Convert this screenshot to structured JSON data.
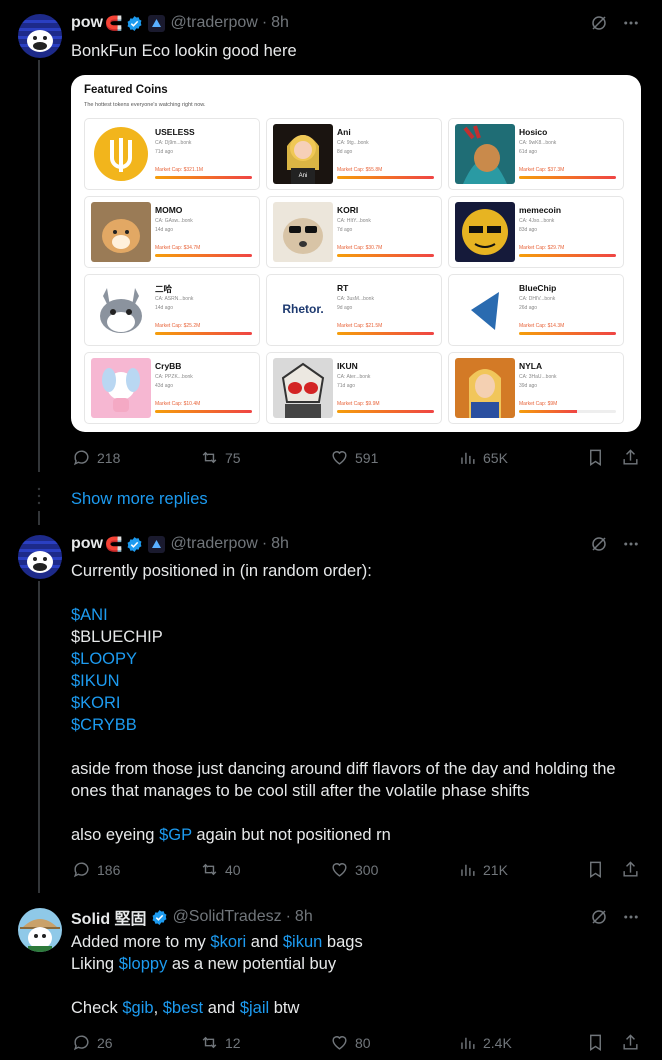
{
  "tweets": [
    {
      "name": "pow",
      "handle": "@traderpow",
      "sep": "·",
      "time": "8h",
      "text": "BonkFun Eco lookin good here",
      "actions": {
        "replies": "218",
        "reposts": "75",
        "likes": "591",
        "views": "65K"
      }
    },
    {
      "name": "pow",
      "handle": "@traderpow",
      "sep": "·",
      "time": "8h",
      "intro": "Currently positioned in (in random order):",
      "tickers": [
        "$ANI",
        "$BLUECHIP",
        "$LOOPY",
        "$IKUN",
        "$KORI",
        "$CRYBB"
      ],
      "para1_line1": "aside from those just dancing around diff flavors of the day and holding the",
      "para1_line2": "ones that manages to be cool still after the volatile phase shifts",
      "para2_pre": "also eyeing ",
      "para2_link": "$GP",
      "para2_post": " again but not positioned rn",
      "actions": {
        "replies": "186",
        "reposts": "40",
        "likes": "300",
        "views": "21K"
      }
    },
    {
      "name": "Solid 堅固",
      "handle": "@SolidTradesz",
      "sep": "·",
      "time": "8h",
      "l1_pre": "Added more to my ",
      "l1_link1": "$kori",
      "l1_mid": " and ",
      "l1_link2": "$ikun",
      "l1_post": " bags",
      "l2_pre": "Liking ",
      "l2_link": "$loppy",
      "l2_post": " as a new potential buy",
      "l3_pre": "Check ",
      "l3_link1": "$gib",
      "l3_sep1": ", ",
      "l3_link2": "$best",
      "l3_mid": " and ",
      "l3_link3": "$jail",
      "l3_post": " btw",
      "actions": {
        "replies": "26",
        "reposts": "12",
        "likes": "80",
        "views": "2.4K"
      }
    }
  ],
  "show_more": "Show more replies",
  "media": {
    "title": "Featured Coins",
    "subtitle": "The hottest tokens everyone's watching right now.",
    "coins": [
      {
        "name": "USELESS",
        "ca": "CA: Dj9m...bonk",
        "age": "71d ago",
        "cap": "Market Cap: $321.1M",
        "fill": 1.0
      },
      {
        "name": "Ani",
        "ca": "CA: 9tg...bonk",
        "age": "8d ago",
        "cap": "Market Cap: $55.8M",
        "fill": 1.0,
        "img_label": "Ani"
      },
      {
        "name": "Hosico",
        "ca": "CA: 9wK8...bonk",
        "age": "61d ago",
        "cap": "Market Cap: $37.3M",
        "fill": 1.0
      },
      {
        "name": "MOMO",
        "ca": "CA: GAsw...bonk",
        "age": "14d ago",
        "cap": "Market Cap: $34.7M",
        "fill": 1.0
      },
      {
        "name": "KORI",
        "ca": "CA: HItY...bonk",
        "age": "7d ago",
        "cap": "Market Cap: $30.7M",
        "fill": 1.0
      },
      {
        "name": "memecoin",
        "ca": "CA: 4Jso...bonk",
        "age": "83d ago",
        "cap": "Market Cap: $29.7M",
        "fill": 1.0
      },
      {
        "name": "二哈",
        "ca": "CA: ASRN...bonk",
        "age": "14d ago",
        "cap": "Market Cap: $25.2M",
        "fill": 1.0
      },
      {
        "name": "RT",
        "ca": "CA: 3usM...bonk",
        "age": "9d ago",
        "cap": "Market Cap: $21.5M",
        "fill": 1.0,
        "img_label": "Rhetor."
      },
      {
        "name": "BlueChip",
        "ca": "CA: DHIV...bonk",
        "age": "26d ago",
        "cap": "Market Cap: $14.3M",
        "fill": 1.0
      },
      {
        "name": "CryBB",
        "ca": "CA: PPZK...bonk",
        "age": "43d ago",
        "cap": "Market Cap: $10.4M",
        "fill": 1.0
      },
      {
        "name": "IKUN",
        "ca": "CA: Ater...bonk",
        "age": "71d ago",
        "cap": "Market Cap: $9.9M",
        "fill": 1.0
      },
      {
        "name": "NYLA",
        "ca": "CA: 3HaU...bonk",
        "age": "39d ago",
        "cap": "Market Cap: $9M",
        "fill": 0.6
      }
    ]
  },
  "colors": {
    "bg": "#000000",
    "text": "#e7e9ea",
    "muted": "#71767b",
    "link": "#1d9bf0",
    "line": "#333639"
  }
}
